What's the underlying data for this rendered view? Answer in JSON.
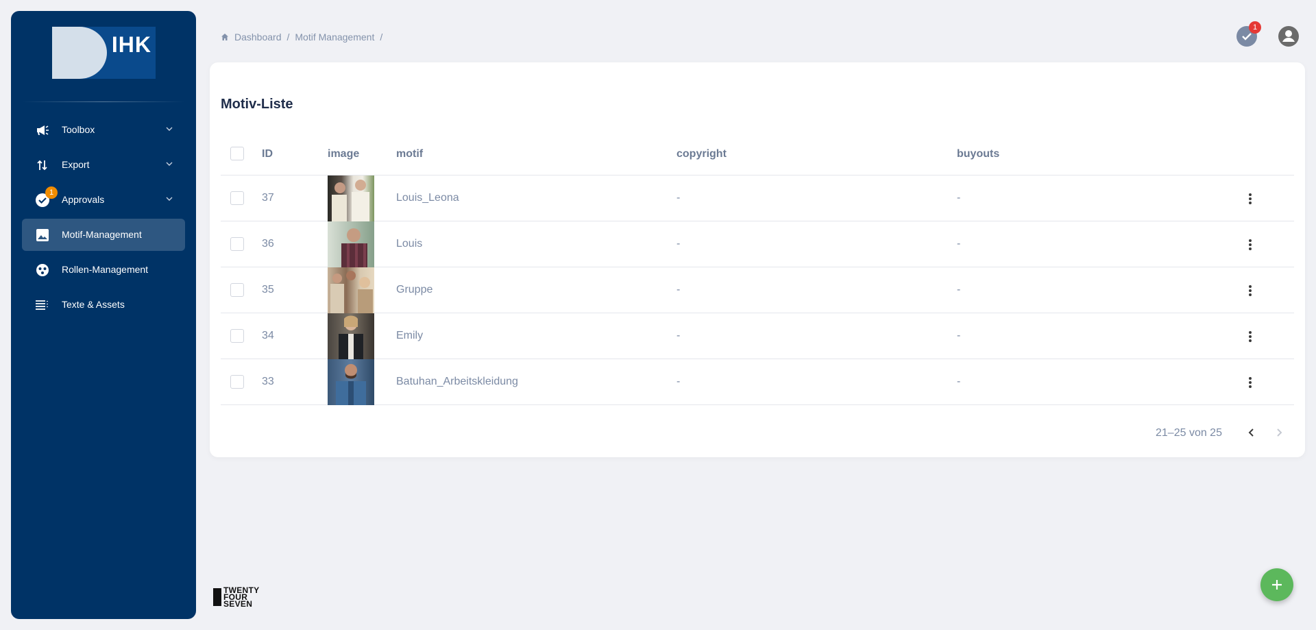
{
  "sidebar": {
    "logo_text": "IHK",
    "items": [
      {
        "label": "Toolbox",
        "icon": "megaphone-icon",
        "has_chevron": true
      },
      {
        "label": "Export",
        "icon": "swap-vertical-icon",
        "has_chevron": true
      },
      {
        "label": "Approvals",
        "icon": "check-circle-icon",
        "has_chevron": true,
        "badge": "1"
      },
      {
        "label": "Motif-Management",
        "icon": "image-icon",
        "active": true
      },
      {
        "label": "Rollen-Management",
        "icon": "roles-icon"
      },
      {
        "label": "Texte & Assets",
        "icon": "list-icon"
      }
    ]
  },
  "breadcrumb": {
    "home": "Dashboard",
    "current": "Motif Management",
    "separator": "/"
  },
  "topbar": {
    "approvals_badge": "1"
  },
  "card": {
    "title": "Motiv-Liste"
  },
  "table": {
    "columns": [
      "ID",
      "image",
      "motif",
      "copyright",
      "buyouts"
    ],
    "rows": [
      {
        "id": "37",
        "motif": "Louis_Leona",
        "copyright": "-",
        "buyouts": "-"
      },
      {
        "id": "36",
        "motif": "Louis",
        "copyright": "-",
        "buyouts": "-"
      },
      {
        "id": "35",
        "motif": "Gruppe",
        "copyright": "-",
        "buyouts": "-"
      },
      {
        "id": "34",
        "motif": "Emily",
        "copyright": "-",
        "buyouts": "-"
      },
      {
        "id": "33",
        "motif": "Batuhan_Arbeitskleidung",
        "copyright": "-",
        "buyouts": "-"
      }
    ]
  },
  "pagination": {
    "range_text": "21–25 von 25"
  },
  "footer": {
    "brand_lines": [
      "TWENTY",
      "FOUR",
      "SEVEN"
    ]
  },
  "colors": {
    "sidebar_bg": "#003366",
    "active_item_bg": "#2d5680",
    "fab_bg": "#5cb85c",
    "badge_orange": "#f08c00",
    "badge_red": "#e53935"
  }
}
